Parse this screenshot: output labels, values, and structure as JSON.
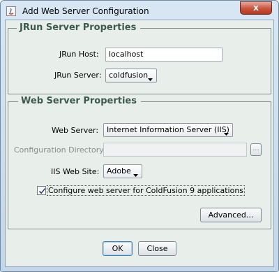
{
  "window": {
    "title": "Add Web Server Configuration",
    "close_label": "x"
  },
  "jrun": {
    "group_title": "JRun Server Properties",
    "host_label": "JRun Host:",
    "host_value": "localhost",
    "server_label": "JRun Server:",
    "server_value": "coldfusion"
  },
  "web": {
    "group_title": "Web Server Properties",
    "server_label": "Web Server:",
    "server_value": "Internet Information Server (IIS)",
    "config_dir_label": "Configuration Directory:",
    "config_dir_value": "",
    "browse_label": "...",
    "site_label": "IIS Web Site:",
    "site_value": "Adobe",
    "configure_checkbox_label": "Configure web server for ColdFusion 9 applications",
    "configure_checked": true,
    "advanced_label": "Advanced..."
  },
  "footer": {
    "ok_label": "OK",
    "close_label": "Close"
  },
  "colors": {
    "frame": "#c3d7e8",
    "panel": "#e8eeea",
    "group_title": "#3b5a50",
    "close_button": "#c7543c"
  }
}
